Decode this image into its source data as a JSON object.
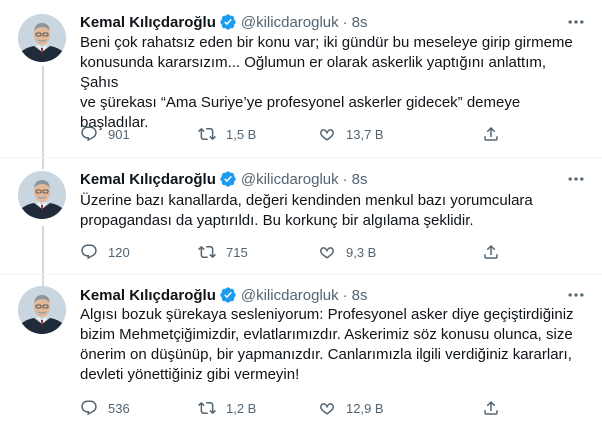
{
  "tweets": [
    {
      "name": "Kemal Kılıçdaroğlu",
      "handle": "@kilicdarogluk",
      "separator": "·",
      "time": "8s",
      "text": "Beni çok rahatsız eden bir konu var; iki gündür bu meseleye girip girmeme\nkonusunda kararsızım... Oğlumun er olarak askerlik yaptığını anlattım, Şahıs\nve şürekası “Ama Suriye’ye profesyonel askerler gidecek” demeye\nbaşladılar.",
      "replies": "901",
      "retweets": "1,5 B",
      "likes": "13,7 B"
    },
    {
      "name": "Kemal Kılıçdaroğlu",
      "handle": "@kilicdarogluk",
      "separator": "·",
      "time": "8s",
      "text": "Üzerine bazı kanallarda, değeri kendinden menkul bazı yorumculara\npropagandası da yaptırıldı. Bu korkunç bir algılama şeklidir.",
      "replies": "120",
      "retweets": "715",
      "likes": "9,3 B"
    },
    {
      "name": "Kemal Kılıçdaroğlu",
      "handle": "@kilicdarogluk",
      "separator": "·",
      "time": "8s",
      "text": "Algısı bozuk şürekaya sesleniyorum: Profesyonel asker diye geçiştirdiğiniz\nbizim Mehmetçiğimizdir, evlatlarımızdır. Askerimiz söz konusu olunca, size\nönerim on düşünüp, bir yapmanızdır. Canlarımızla ilgili verdiğiniz kararları,\ndevleti yönettiğiniz gibi vermeyin!",
      "replies": "536",
      "retweets": "1,2 B",
      "likes": "12,9 B"
    }
  ],
  "icons": {
    "verified": "verified-badge-icon",
    "more": "more-options-icon",
    "reply": "reply-icon",
    "retweet": "retweet-icon",
    "like": "like-icon",
    "share": "share-icon"
  },
  "colors": {
    "verified": "#1d9bf0",
    "text": "#0f1419",
    "secondary": "#536471",
    "thread_line": "#cfd9de",
    "separator": "#eff3f4"
  }
}
